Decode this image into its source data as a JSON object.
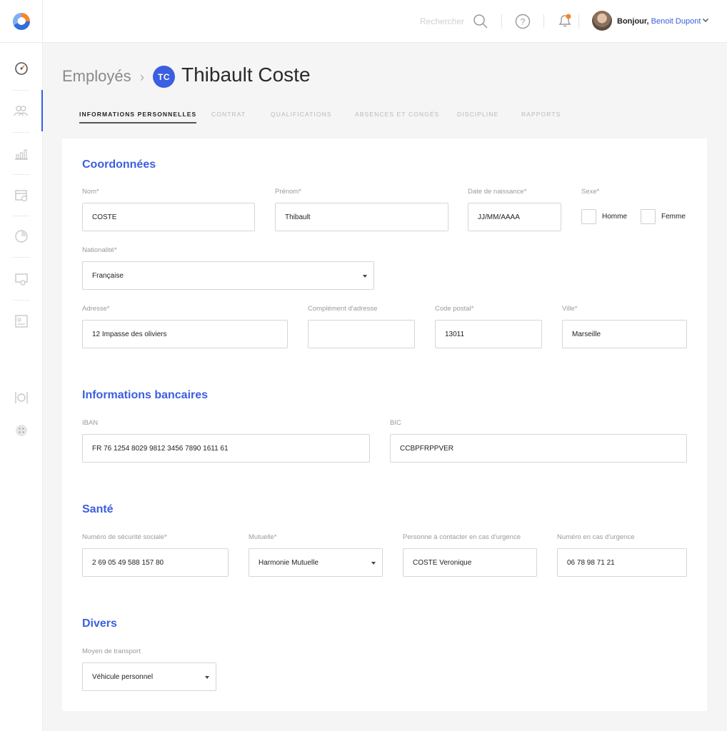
{
  "header": {
    "search_label": "Rechercher",
    "greeting": "Bonjour,",
    "user_name": "Benoit Dupont"
  },
  "breadcrumb": {
    "parent": "Employés",
    "separator": "›",
    "initials": "TC",
    "title": "Thibault Coste"
  },
  "tabs": [
    {
      "label": "INFORMATIONS PERSONNELLES",
      "active": true
    },
    {
      "label": "CONTRAT"
    },
    {
      "label": "QUALIFICATIONS"
    },
    {
      "label": "ABSENCES ET CONGÉS"
    },
    {
      "label": "DISCIPLINE"
    },
    {
      "label": "RAPPORTS"
    }
  ],
  "coordonnees": {
    "heading": "Coordonnées",
    "nom": {
      "label": "Nom*",
      "value": "COSTE"
    },
    "prenom": {
      "label": "Prénom*",
      "value": "Thibault"
    },
    "naissance": {
      "label": "Date de naissance*",
      "value": "JJ/MM/AAAA"
    },
    "sexe": {
      "label": "Sexe*",
      "homme": "Homme",
      "femme": "Femme"
    },
    "nationalite": {
      "label": "Nationalité*",
      "value": "Française"
    },
    "adresse": {
      "label": "Adresse*",
      "value": "12 Impasse des oliviers"
    },
    "complement": {
      "label": "Complément d'adresse",
      "value": ""
    },
    "code_postal": {
      "label": "Code postal*",
      "value": "13011"
    },
    "ville": {
      "label": "Ville*",
      "value": "Marseille"
    }
  },
  "bancaires": {
    "heading": "Informations bancaires",
    "iban": {
      "label": "IBAN",
      "value": "FR 76 1254 8029 9812 3456 7890 1611 61"
    },
    "bic": {
      "label": "BIC",
      "value": "CCBPFRPPVER"
    }
  },
  "sante": {
    "heading": "Santé",
    "secu": {
      "label": "Numéro de sécurité sociale*",
      "value": "2 69 05 49 588 157 80"
    },
    "mutuelle": {
      "label": "Mutuelle*",
      "value": "Harmonie Mutuelle"
    },
    "contact": {
      "label": "Personne à contacter en cas d'urgence",
      "value": "COSTE Veronique"
    },
    "numero_urgence": {
      "label": "Numéro en cas d'urgence",
      "value": "06 78 98 71 21"
    }
  },
  "divers": {
    "heading": "Divers",
    "transport": {
      "label": "Moyen de transport",
      "value": "Véhicule personnel"
    }
  },
  "icons": {
    "logo": "app-logo",
    "nav": [
      "dashboard-icon",
      "users-icon",
      "chart-icon",
      "calendar-icon",
      "pie-chart-icon",
      "training-icon",
      "document-icon",
      "restaurant-icon",
      "apps-icon"
    ]
  },
  "colors": {
    "accent": "#3a5fe0",
    "notification": "#f5872b",
    "logo_orange": "#f5872b",
    "logo_blue": "#2f6fd8"
  }
}
